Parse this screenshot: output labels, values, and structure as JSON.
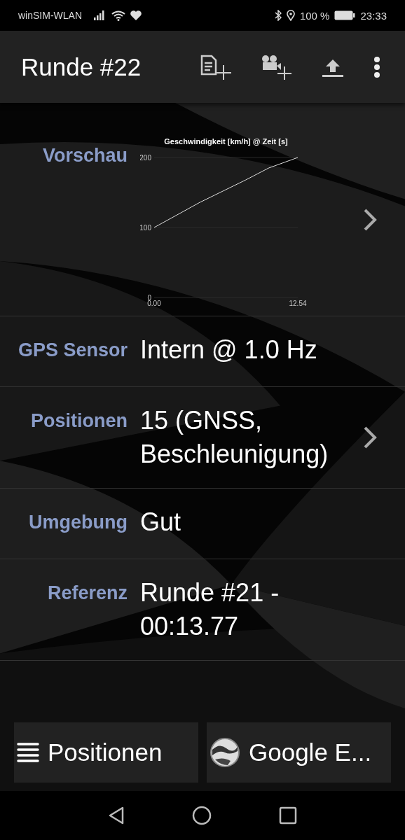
{
  "status_bar": {
    "carrier": "winSIM-WLAN",
    "battery": "100 %",
    "time": "23:33"
  },
  "app_bar": {
    "title": "Runde #22"
  },
  "rows": [
    {
      "kind": "chart",
      "label": "Vorschau",
      "chevron": true,
      "chart_data": {
        "type": "line",
        "title": "Geschwindigkeit [km/h] @ Zeit [s]",
        "x": [
          0,
          2,
          4,
          6,
          8,
          10,
          12.54
        ],
        "series": [
          {
            "color": "#dddddd",
            "values": [
              100,
              118,
              136,
              152,
              168,
              185,
              200
            ]
          }
        ],
        "xlim": [
          0,
          12.54
        ],
        "ylim": [
          0,
          200
        ],
        "xticks": [
          {
            "value": 0,
            "label": "0.00"
          },
          {
            "value": 12.54,
            "label": "12.54"
          }
        ],
        "yticks": [
          0,
          100,
          200
        ]
      }
    },
    {
      "kind": "text",
      "label": "GPS Sensor",
      "value": "Intern @ 1.0 Hz",
      "chevron": false
    },
    {
      "kind": "text",
      "label": "Positionen",
      "value": "15 (GNSS, Beschleunigung)",
      "chevron": true
    },
    {
      "kind": "text",
      "label": "Umgebung",
      "value": "Gut",
      "chevron": false
    },
    {
      "kind": "text",
      "label": "Referenz",
      "value": "Runde #21 - 00:13.77",
      "chevron": false
    }
  ],
  "buttons": [
    {
      "label": "Positionen"
    },
    {
      "label": "Google E..."
    }
  ]
}
